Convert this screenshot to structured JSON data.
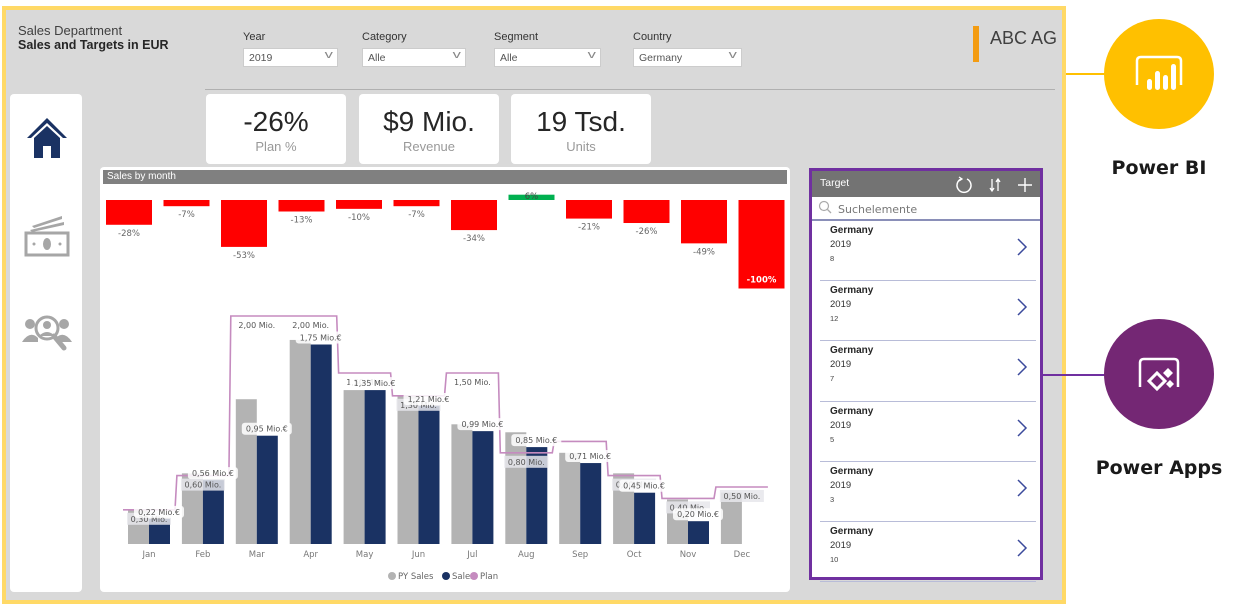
{
  "header": {
    "subtitle": "Sales Department",
    "title": "Sales and Targets in EUR",
    "brand": "ABC AG"
  },
  "filters": [
    {
      "label": "Year",
      "value": "2019"
    },
    {
      "label": "Category",
      "value": "Alle"
    },
    {
      "label": "Segment",
      "value": "Alle"
    },
    {
      "label": "Country",
      "value": "Germany"
    }
  ],
  "nav": [
    {
      "icon": "home-icon",
      "active": true
    },
    {
      "icon": "money-icon",
      "active": false
    },
    {
      "icon": "people-search-icon",
      "active": false
    }
  ],
  "kpis": [
    {
      "value": "-26%",
      "label": "Plan %"
    },
    {
      "value": "$9 Mio.",
      "label": "Revenue"
    },
    {
      "value": "19 Tsd.",
      "label": "Units"
    }
  ],
  "colors": {
    "negative": "#ff0000",
    "positive": "#00b050",
    "py_sales": "#b3b3b3",
    "sales": "#1a3263",
    "plan": "#c58bbf",
    "powerbi": "#ffc000",
    "powerapps": "#742774",
    "frame": "#ffd966"
  },
  "chart_data": [
    {
      "type": "bar",
      "title": "Sales by month",
      "categories": [
        "Jan",
        "Feb",
        "Mar",
        "Apr",
        "May",
        "Jun",
        "Jul",
        "Aug",
        "Sep",
        "Oct",
        "Nov",
        "Dec"
      ],
      "values": [
        -28,
        -7,
        -53,
        -13,
        -10,
        -7,
        -34,
        6,
        -21,
        -26,
        -49,
        -100
      ],
      "labels": [
        "-28%",
        "-7%",
        "-53%",
        "-13%",
        "-10%",
        "-7%",
        "-34%",
        "6%",
        "-21%",
        "-26%",
        "-49%",
        "-100%"
      ],
      "unit": "%"
    },
    {
      "type": "bar",
      "title": "",
      "categories": [
        "Jan",
        "Feb",
        "Mar",
        "Apr",
        "May",
        "Jun",
        "Jul",
        "Aug",
        "Sep",
        "Oct",
        "Nov",
        "Dec"
      ],
      "series": [
        {
          "name": "PY Sales",
          "values": [
            0.3,
            0.62,
            1.27,
            1.79,
            1.35,
            1.3,
            1.05,
            0.98,
            0.8,
            0.62,
            0.39,
            0.45
          ]
        },
        {
          "name": "Sales",
          "values": [
            0.22,
            0.56,
            0.95,
            1.75,
            1.35,
            1.21,
            0.99,
            0.85,
            0.71,
            0.45,
            0.2,
            null
          ],
          "labels": [
            "0,22 Mio.€",
            "0,56 Mio.€",
            "0,95 Mio.€",
            "1,75 Mio.€",
            "1,35 Mio.€",
            "1,21 Mio.€",
            "0,99 Mio.€",
            "0,85 Mio.€",
            "0,71 Mio.€",
            "0,45 Mio.€",
            "0,20 Mio.€",
            ""
          ]
        },
        {
          "name": "Plan",
          "type": "step-line",
          "values": [
            0.3,
            0.6,
            2.0,
            2.0,
            1.5,
            1.3,
            1.5,
            0.8,
            0.9,
            0.6,
            0.4,
            0.5
          ],
          "labels": [
            "0,30 Mio.",
            "0,60 Mio.",
            "2,00 Mio.",
            "2,00 Mio.",
            "1,50 Mio.",
            "1,30 Mio.",
            "1,50 Mio.",
            "0,80 Mio.",
            "",
            "0,60 Mio.",
            "0,40 Mio.",
            "0,50 Mio."
          ]
        }
      ],
      "legend": [
        "PY Sales",
        "Sales",
        "Plan"
      ],
      "legend_position": "bottom-center",
      "ylim": [
        0,
        2.1
      ],
      "unit": "Mio. €"
    }
  ],
  "powerapps": {
    "title": "Target",
    "search_placeholder": "Suchelemente",
    "items": [
      {
        "country": "Germany",
        "year": "2019",
        "value": "8"
      },
      {
        "country": "Germany",
        "year": "2019",
        "value": "12"
      },
      {
        "country": "Germany",
        "year": "2019",
        "value": "7"
      },
      {
        "country": "Germany",
        "year": "2019",
        "value": "5"
      },
      {
        "country": "Germany",
        "year": "2019",
        "value": "3"
      },
      {
        "country": "Germany",
        "year": "2019",
        "value": "10"
      }
    ]
  },
  "annotations": {
    "powerbi_label": "Power BI",
    "powerapps_label": "Power Apps"
  }
}
